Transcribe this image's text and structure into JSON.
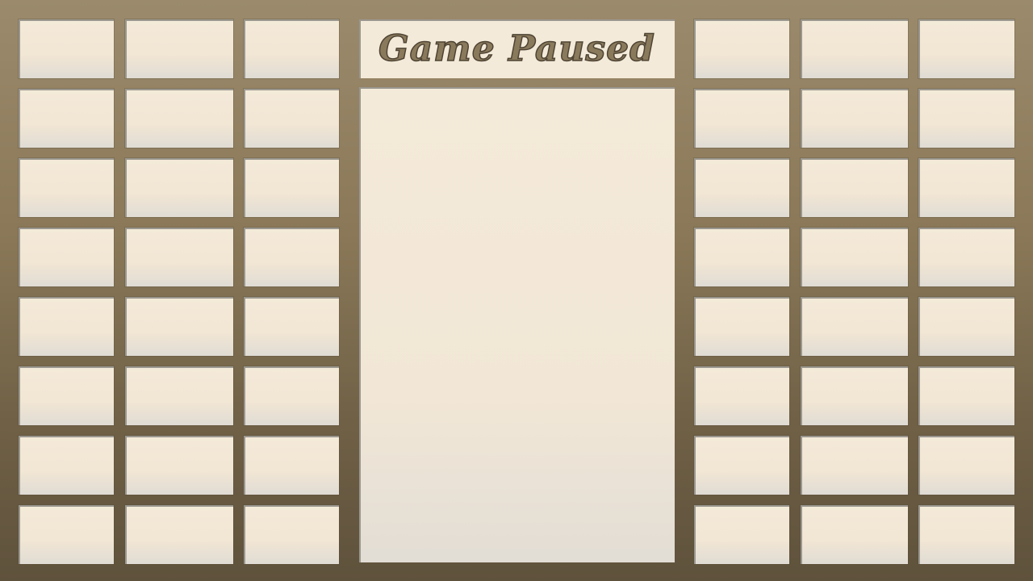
{
  "title": "Game Paused",
  "colors": {
    "frame": "#8a7858",
    "panel": "#f4ead9",
    "title_text": "#8a7a5c"
  }
}
